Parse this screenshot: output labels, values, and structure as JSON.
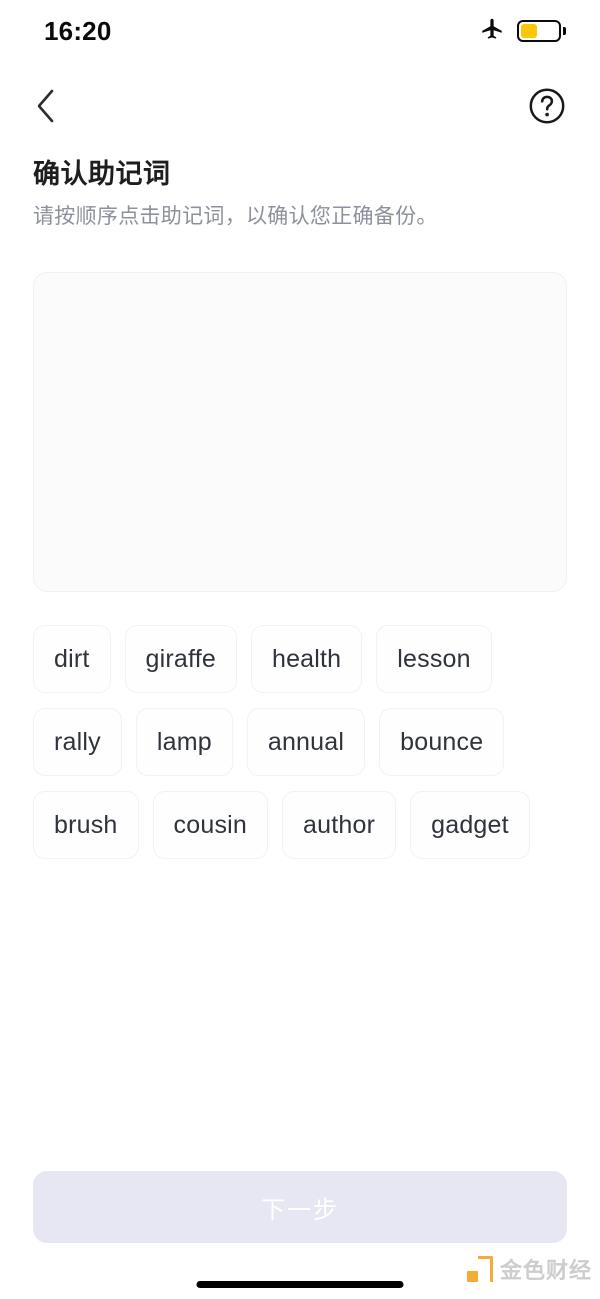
{
  "status_bar": {
    "time": "16:20",
    "airplane_icon": "airplane-mode-icon",
    "battery_icon": "battery-low-power-icon",
    "battery_level_percent": 45,
    "battery_color": "#fcc60b"
  },
  "nav": {
    "back_icon": "chevron-left-icon",
    "help_icon": "question-mark-circle-icon"
  },
  "heading": {
    "title": "确认助记词",
    "subtitle": "请按顺序点击助记词，以确认您正确备份。"
  },
  "answer_area": {
    "selected_words": [],
    "placeholder": ""
  },
  "word_pool": {
    "words": [
      "dirt",
      "giraffe",
      "health",
      "lesson",
      "rally",
      "lamp",
      "annual",
      "bounce",
      "brush",
      "cousin",
      "author",
      "gadget"
    ]
  },
  "footer": {
    "next_label": "下一步",
    "next_enabled": false,
    "next_disabled_bg": "#e7e7f3",
    "next_disabled_text_color": "#ffffff"
  },
  "watermark": {
    "text": "金色财经",
    "logo_icon": "jinse-logo-icon",
    "logo_color": "#f5a623"
  }
}
